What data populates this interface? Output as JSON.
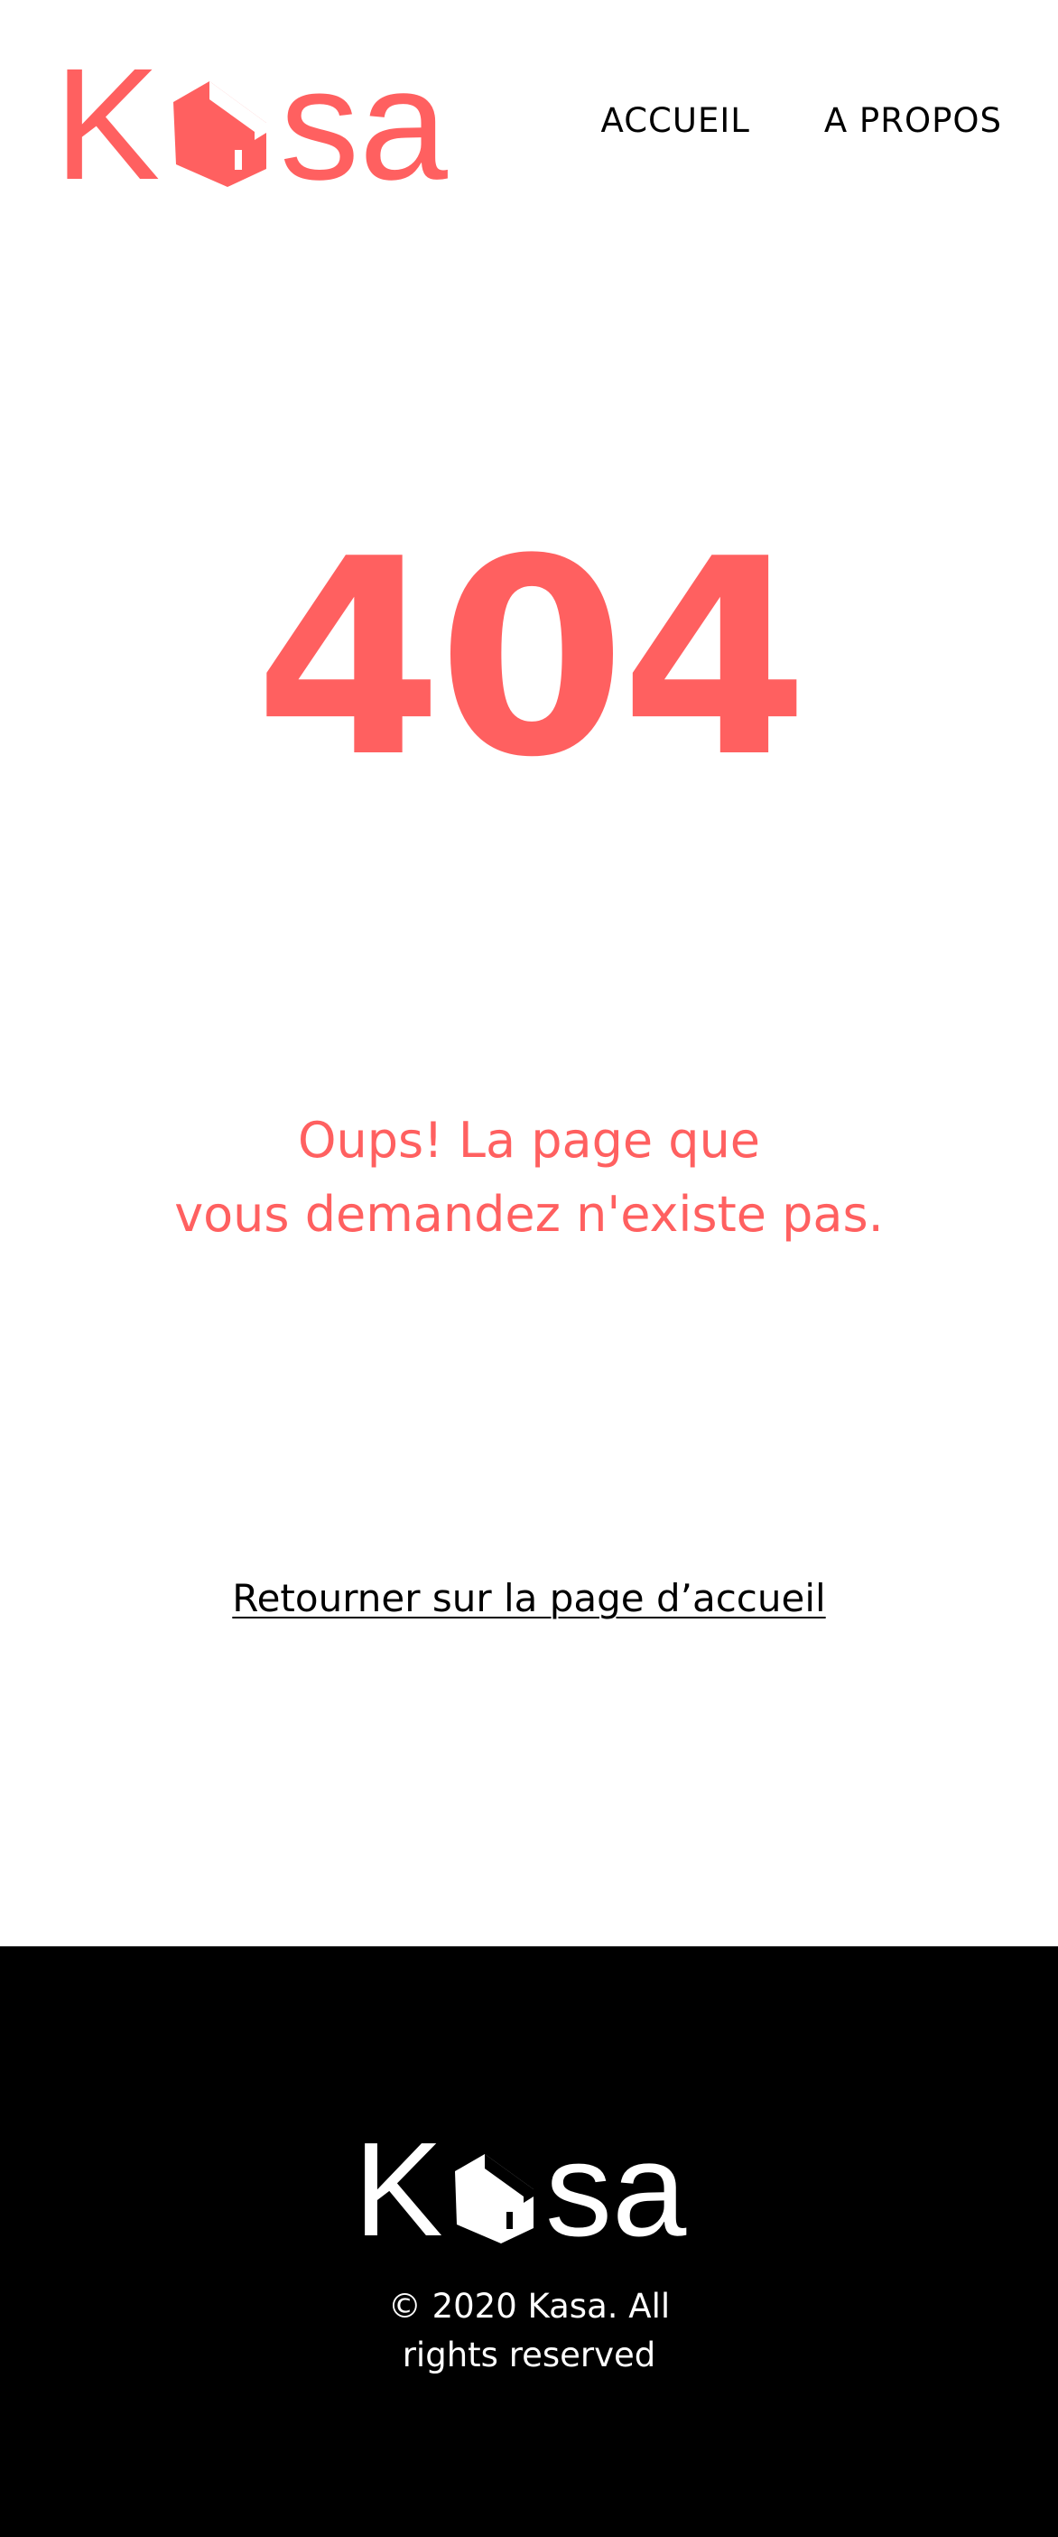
{
  "header": {
    "logo": {
      "text_before": "K",
      "text_after": "sa",
      "icon": "house-icon",
      "color": "#FF6060"
    },
    "nav": {
      "home_label": "ACCUEIL",
      "about_label": "A PROPOS"
    }
  },
  "main": {
    "error_code": "404",
    "message_line1": "Oups! La page que",
    "message_line2": "vous demandez n'existe pas.",
    "home_link_label": "Retourner sur la page d’accueil",
    "accent_color": "#FF6060"
  },
  "footer": {
    "logo": {
      "text_before": "K",
      "text_after": "sa",
      "icon": "house-icon",
      "color": "#FFFFFF"
    },
    "copyright_line1": "© 2020 Kasa. All",
    "copyright_line2": "rights reserved",
    "background": "#000000"
  }
}
